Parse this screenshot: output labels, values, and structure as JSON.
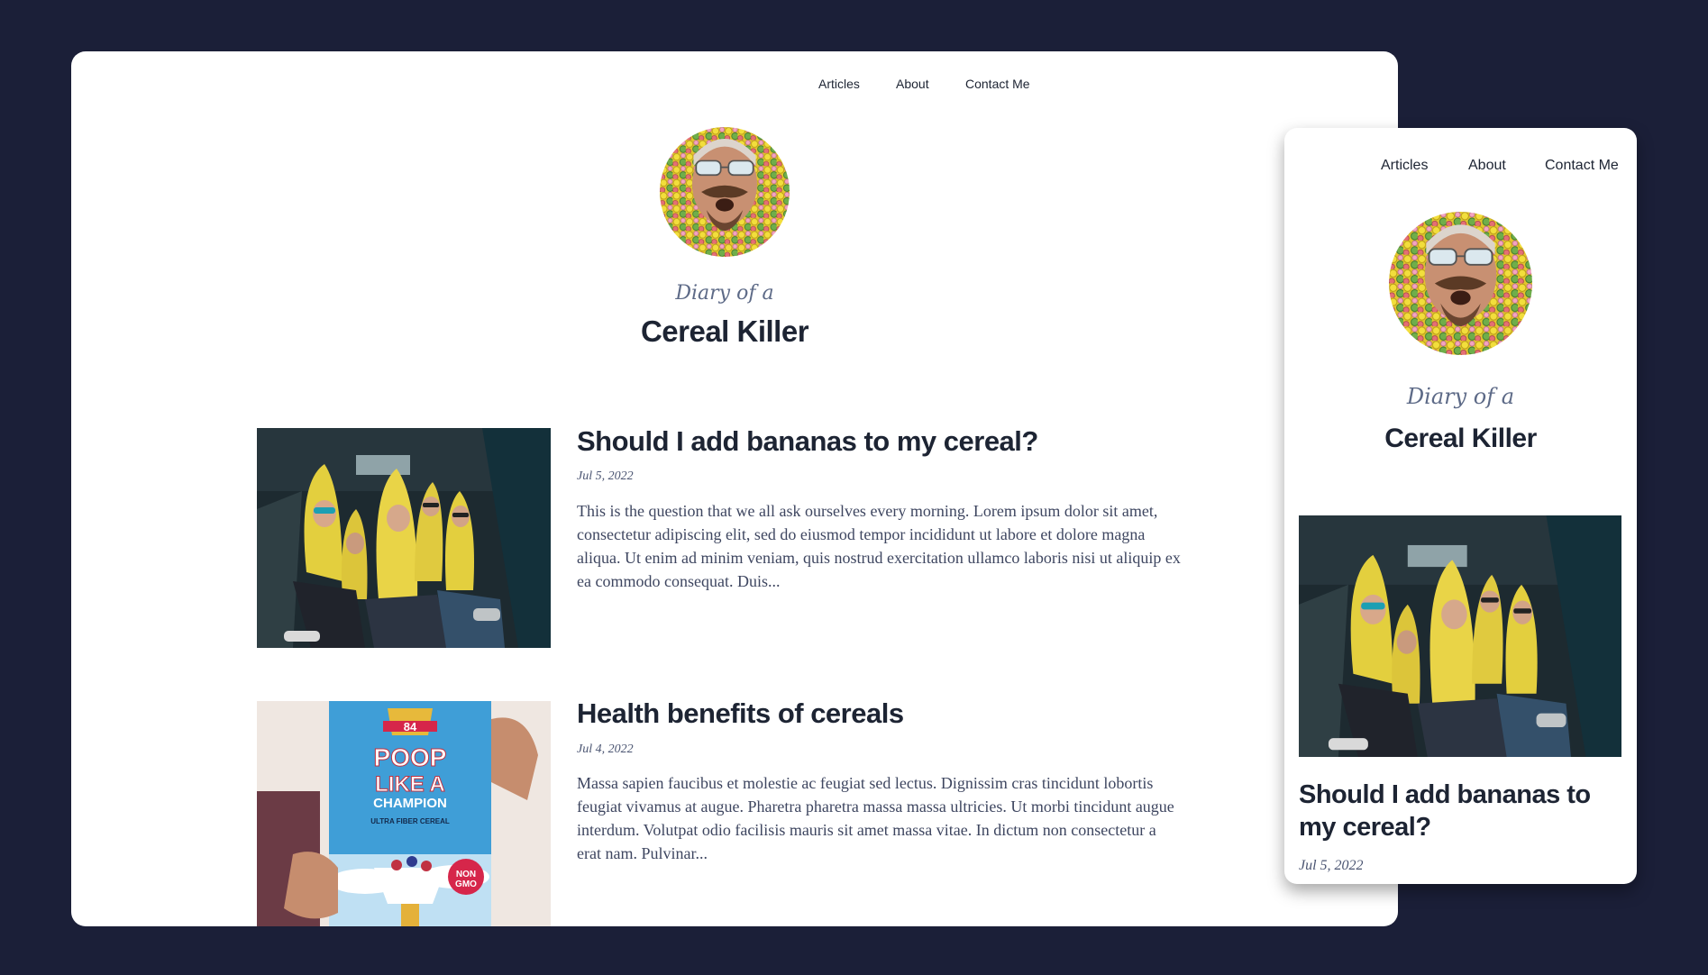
{
  "nav": {
    "items": [
      {
        "label": "Articles"
      },
      {
        "label": "About"
      },
      {
        "label": "Contact Me"
      }
    ]
  },
  "blog": {
    "eyebrow": "Diary of a",
    "name": "Cereal Killer",
    "avatar_icon": "avatar-face-cereal-image"
  },
  "posts": [
    {
      "title": "Should I add bananas to my cereal?",
      "date": "Jul 5, 2022",
      "excerpt": "This is the question that we all ask ourselves every morning. Lorem ipsum dolor sit amet, consectetur adipiscing elit, sed do eiusmod tempor incididunt ut labore et dolore magna aliqua. Ut enim ad minim veniam, quis nostrud exercitation ullamco laboris nisi ut aliquip ex ea commodo consequat. Duis...",
      "image": "bananas-costume-photo"
    },
    {
      "title": "Health benefits of cereals",
      "date": "Jul 4, 2022",
      "excerpt": "Massa sapien faucibus et molestie ac feugiat sed lectus. Dignissim cras tincidunt lobortis feugiat vivamus at augue. Pharetra pharetra massa massa ultricies. Ut morbi tincidunt augue interdum. Volutpat odio facilisis mauris sit amet massa vitae. In dictum non consectetur a erat nam. Pulvinar...",
      "image": "cereal-box-photo",
      "box_text": {
        "top": "84",
        "line1": "POOP",
        "line2": "LIKE A",
        "line3": "CHAMPION",
        "tagline": "ULTRA FIBER CEREAL",
        "badge1": "NON",
        "badge2": "GMO"
      }
    }
  ],
  "colors": {
    "background": "#1b1f38",
    "card": "#ffffff",
    "text": "#1d2433",
    "muted": "#5d6a87"
  }
}
